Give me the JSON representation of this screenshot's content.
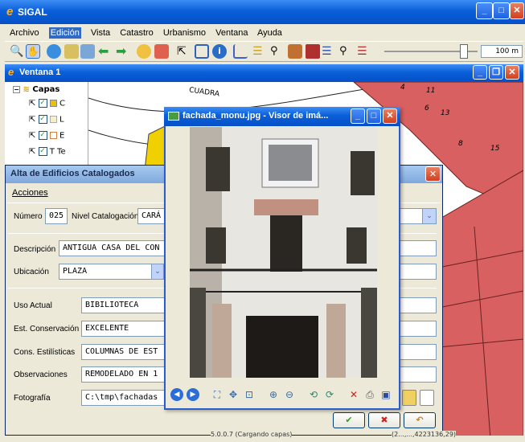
{
  "app": {
    "title": "SIGAL",
    "menu": [
      "Archivo",
      "Edición",
      "Vista",
      "Catastro",
      "Urbanismo",
      "Ventana",
      "Ayuda"
    ],
    "scale_label": "100 m",
    "zoom_slider": 0.85
  },
  "inner_window": {
    "title": "Ventana 1"
  },
  "layers": {
    "root": "Capas",
    "items": [
      "C",
      "L",
      "E",
      "T Te",
      ""
    ]
  },
  "map": {
    "street_label": "CUADRA",
    "numbers": [
      "4",
      "11",
      "6",
      "13",
      "8",
      "15"
    ],
    "status_left": "5.0.0.7 (Cargando capas)",
    "status_right": "(2...,...,4223136,29)"
  },
  "form": {
    "title": "Alta de Edificios Catalogados",
    "menu": "Acciones",
    "numero_label": "Número",
    "numero": "025",
    "nivel_label": "Nivel Catalogación",
    "nivel": "CARÁ",
    "descripcion_label": "Descripción",
    "descripcion": "ANTIGUA CASA DEL CON",
    "ubicacion_label": "Ubicación",
    "ubicacion": "PLAZA",
    "uso_label": "Uso Actual",
    "uso": "BIBILIOTECA",
    "estado_label": "Est. Conservación",
    "estado": "EXCELENTE",
    "cons_label": "Cons. Estilísticas",
    "cons": "COLUMNAS DE EST",
    "obs_label": "Observaciones",
    "obs": "REMODELADO EN 1",
    "foto_label": "Fotografía",
    "foto": "C:\\tmp\\fachadas"
  },
  "viewer": {
    "title": "fachada_monu.jpg - Visor de imá..."
  }
}
